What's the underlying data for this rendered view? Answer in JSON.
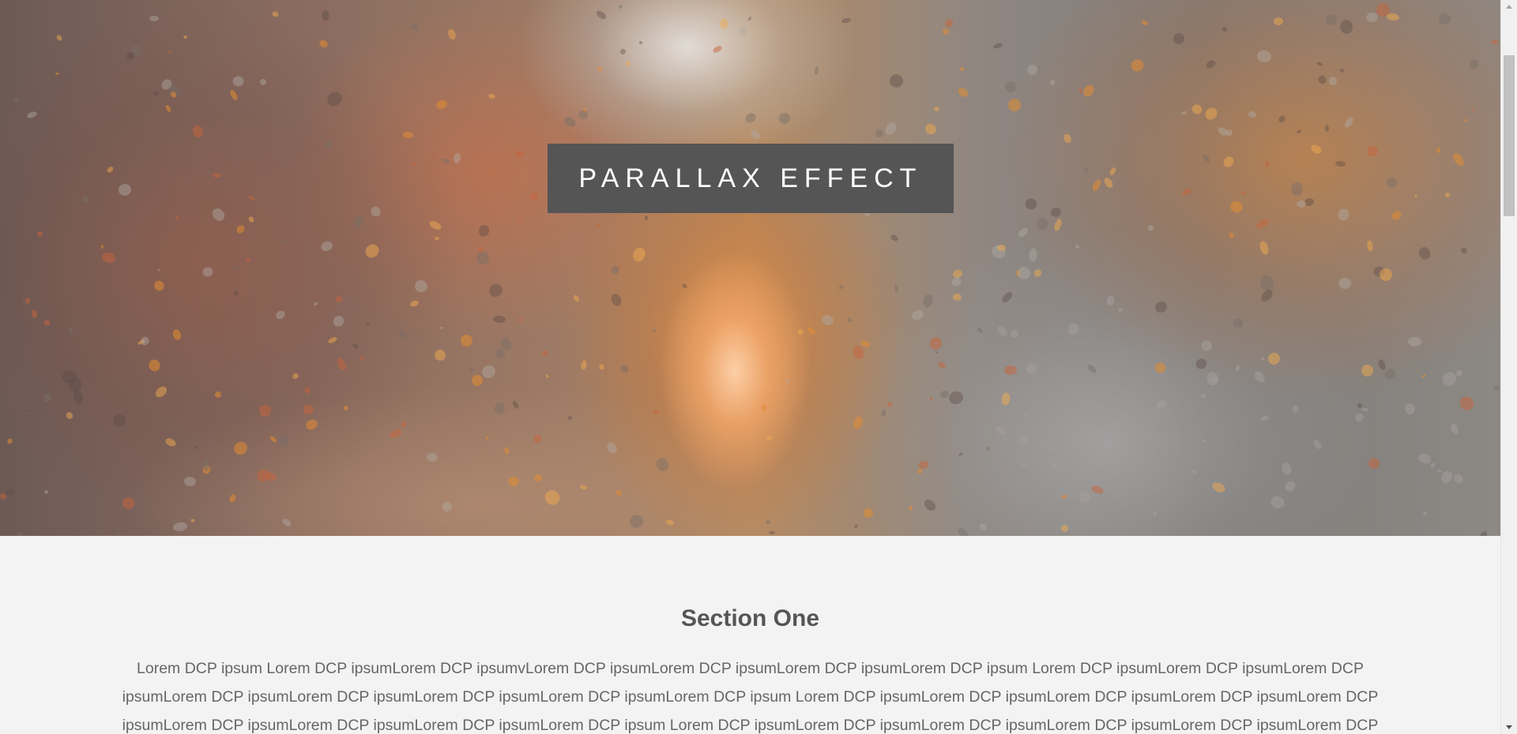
{
  "hero": {
    "title": "PARALLAX EFFECT",
    "background_image": "autumn-forest-path-photo",
    "colors": {
      "title_box": "#555555",
      "title_text": "#ffffff"
    }
  },
  "section_one": {
    "heading": "Section One",
    "body": "Lorem DCP ipsum Lorem DCP ipsumLorem DCP ipsumvLorem DCP ipsumLorem DCP ipsumLorem DCP ipsumLorem DCP ipsum Lorem DCP ipsumLorem DCP ipsumLorem DCP ipsumLorem DCP ipsumLorem DCP ipsumLorem DCP ipsumLorem DCP ipsumLorem DCP ipsum Lorem DCP ipsumLorem DCP ipsumLorem DCP ipsumLorem DCP ipsumLorem DCP ipsumLorem DCP ipsumLorem DCP ipsumLorem DCP ipsumLorem DCP ipsum Lorem DCP ipsumLorem DCP ipsumLorem DCP ipsumLorem DCP ipsumLorem DCP ipsumLorem DCP",
    "colors": {
      "background": "#f3f3f3",
      "heading": "#555555",
      "text": "#666666"
    }
  },
  "scrollbar": {
    "up_icon": "scroll-up-arrow-icon",
    "down_icon": "scroll-down-arrow-icon"
  }
}
